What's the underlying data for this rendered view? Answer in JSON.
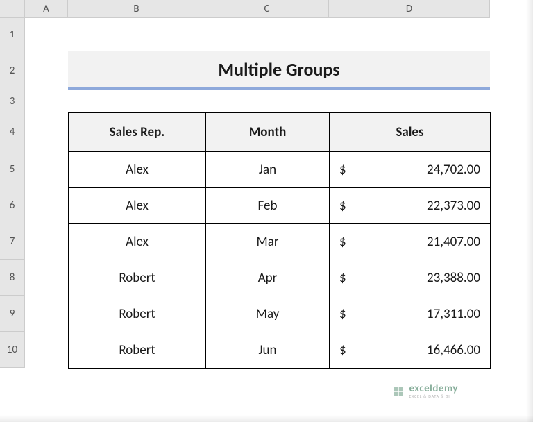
{
  "columns": [
    "A",
    "B",
    "C",
    "D"
  ],
  "rows": [
    "1",
    "2",
    "3",
    "4",
    "5",
    "6",
    "7",
    "8",
    "9",
    "10"
  ],
  "title": "Multiple Groups",
  "headers": {
    "rep": "Sales Rep.",
    "month": "Month",
    "sales": "Sales"
  },
  "currency": "$",
  "data": [
    {
      "rep": "Alex",
      "month": "Jan",
      "sales": "24,702.00"
    },
    {
      "rep": "Alex",
      "month": "Feb",
      "sales": "22,373.00"
    },
    {
      "rep": "Alex",
      "month": "Mar",
      "sales": "21,407.00"
    },
    {
      "rep": "Robert",
      "month": "Apr",
      "sales": "23,388.00"
    },
    {
      "rep": "Robert",
      "month": "May",
      "sales": "17,311.00"
    },
    {
      "rep": "Robert",
      "month": "Jun",
      "sales": "16,466.00"
    }
  ],
  "watermark": {
    "main": "exceldemy",
    "sub": "EXCEL & DATA & BI"
  }
}
